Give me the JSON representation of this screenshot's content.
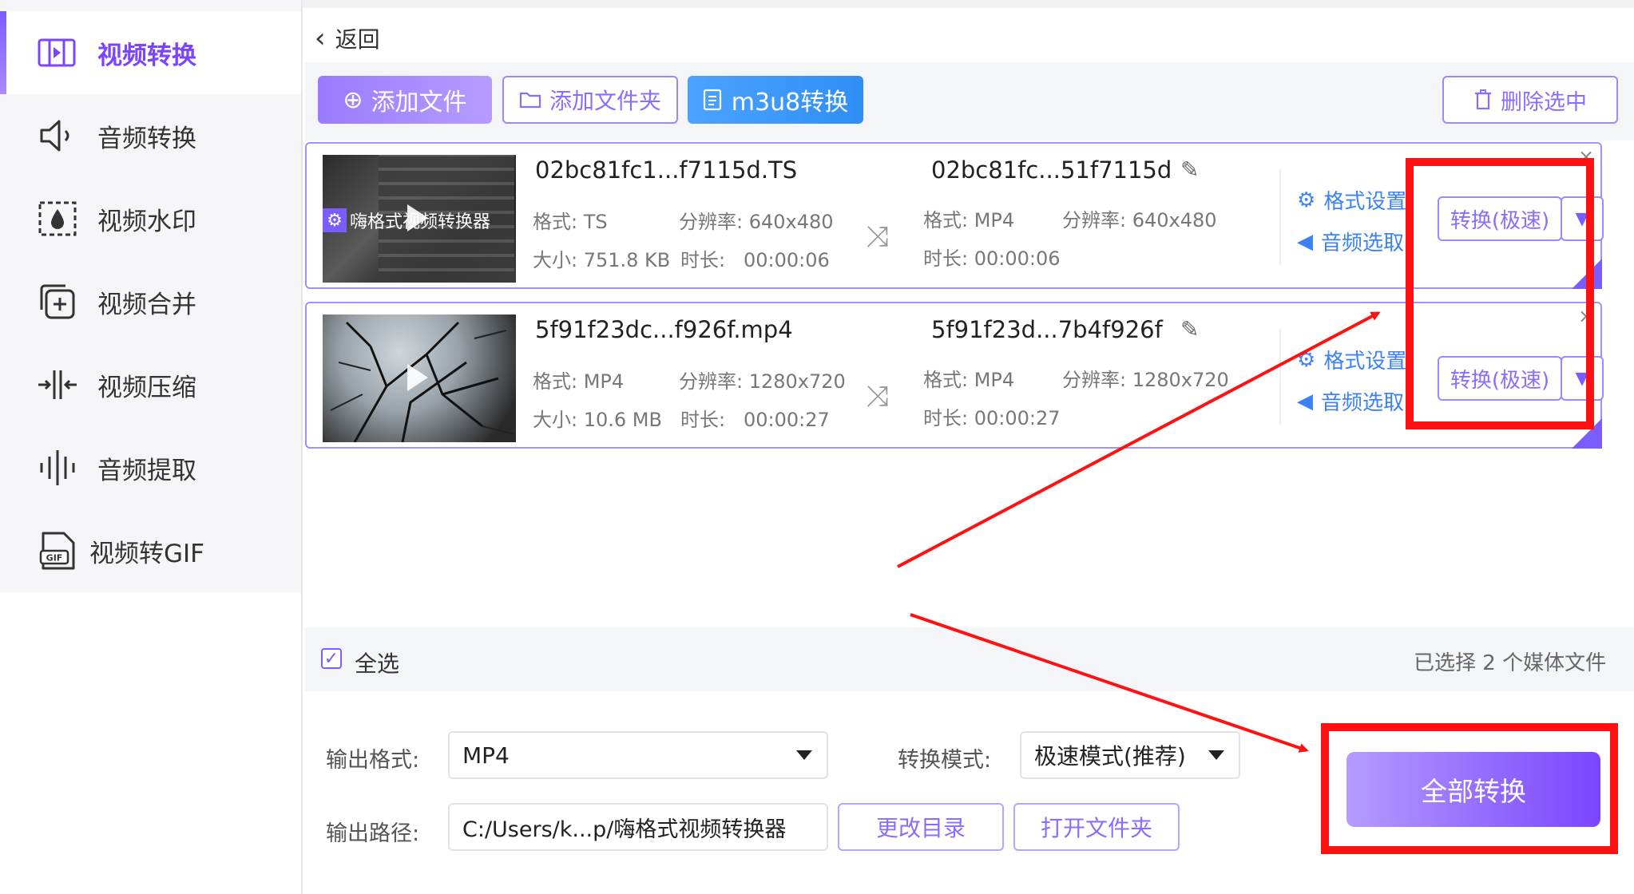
{
  "sidebar": {
    "items": [
      {
        "label": "视频转换",
        "icon": "video-convert-icon",
        "active": true
      },
      {
        "label": "音频转换",
        "icon": "speaker-icon"
      },
      {
        "label": "视频水印",
        "icon": "watermark-icon"
      },
      {
        "label": "视频合并",
        "icon": "merge-plus-icon"
      },
      {
        "label": "视频压缩",
        "icon": "compress-icon"
      },
      {
        "label": "音频提取",
        "icon": "audio-wave-icon"
      },
      {
        "label": "视频转GIF",
        "icon": "gif-file-icon"
      }
    ]
  },
  "header": {
    "back_label": "返回"
  },
  "toolbar": {
    "add_file": "添加文件",
    "add_folder": "添加文件夹",
    "m3u8": "m3u8转换",
    "delete_selected": "删除选中"
  },
  "files": [
    {
      "src_name": "02bc81fc1...f7115d.TS",
      "src_format": "格式: TS",
      "src_resolution": "分辨率: 640x480",
      "src_size": "大小: 751.8 KB",
      "src_duration": "时长:   00:00:06",
      "dst_name": "02bc81fc...51f7115d",
      "dst_format": "格式: MP4",
      "dst_resolution": "分辨率: 640x480",
      "dst_duration": "时长: 00:00:06",
      "thumb_overlay": "嗨格式视频转换器",
      "format_settings": "格式设置",
      "audio_select": "音频选取",
      "convert_label": "转换(极速)"
    },
    {
      "src_name": "5f91f23dc...f926f.mp4",
      "src_format": "格式: MP4",
      "src_resolution": "分辨率: 1280x720",
      "src_size": "大小: 10.6 MB",
      "src_duration": "时长:   00:00:27",
      "dst_name": "5f91f23d...7b4f926f",
      "dst_format": "格式: MP4",
      "dst_resolution": "分辨率: 1280x720",
      "dst_duration": "时长: 00:00:27",
      "format_settings": "格式设置",
      "audio_select": "音频选取",
      "convert_label": "转换(极速)"
    }
  ],
  "selection": {
    "select_all": "全选",
    "checked": true,
    "count_text": "已选择 2 个媒体文件"
  },
  "output": {
    "format_label": "输出格式:",
    "format_value": "MP4",
    "mode_label": "转换模式:",
    "mode_value": "极速模式(推荐)",
    "path_label": "输出路径:",
    "path_value": "C:/Users/k...p/嗨格式视频转换器",
    "change_dir": "更改目录",
    "open_folder": "打开文件夹",
    "convert_all": "全部转换"
  },
  "colors": {
    "accent": "#7b5cff",
    "blue": "#3b82f6",
    "annotation_red": "#ff1111"
  }
}
